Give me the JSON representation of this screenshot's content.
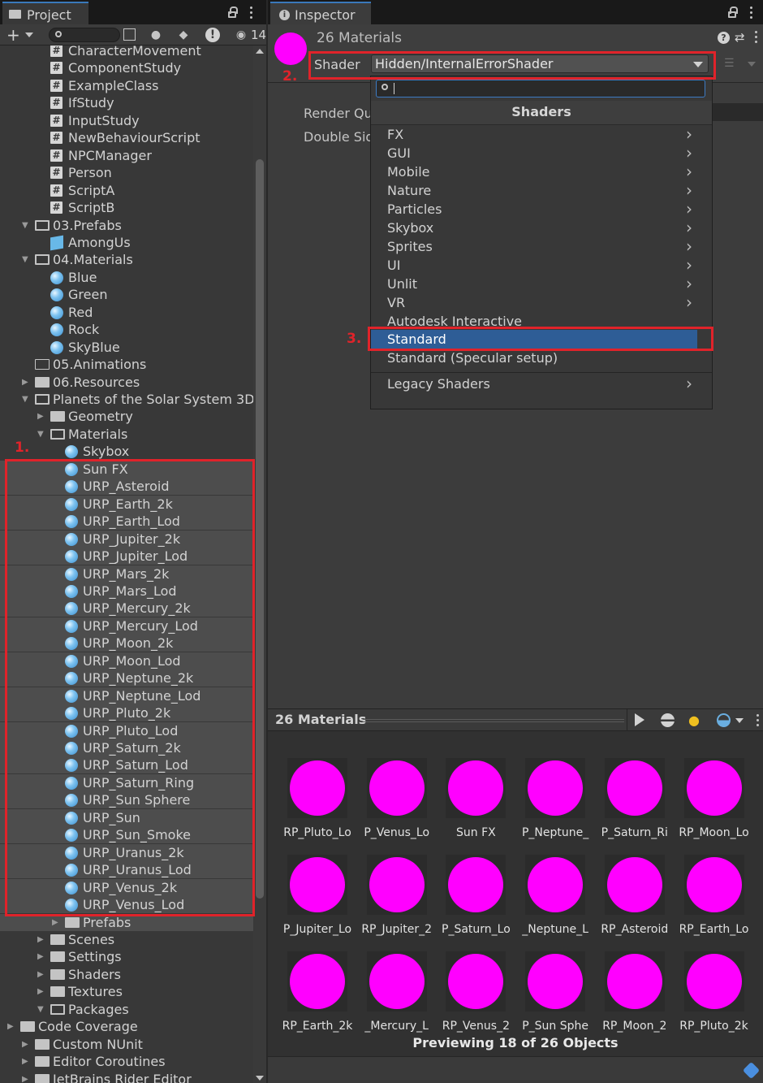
{
  "project": {
    "tab_label": "Project",
    "hidden_count": "14",
    "tree": [
      {
        "label": "CharacterMovement",
        "type": "script"
      },
      {
        "label": "ComponentStudy",
        "type": "script"
      },
      {
        "label": "ExampleClass",
        "type": "script"
      },
      {
        "label": "IfStudy",
        "type": "script"
      },
      {
        "label": "InputStudy",
        "type": "script"
      },
      {
        "label": "NewBehaviourScript",
        "type": "script"
      },
      {
        "label": "NPCManager",
        "type": "script"
      },
      {
        "label": "Person",
        "type": "script"
      },
      {
        "label": "ScriptA",
        "type": "script"
      },
      {
        "label": "ScriptB",
        "type": "script"
      },
      {
        "label": "03.Prefabs",
        "type": "folder-open"
      },
      {
        "label": "AmongUs",
        "type": "prefab"
      },
      {
        "label": "04.Materials",
        "type": "folder-open"
      },
      {
        "label": "Blue",
        "type": "material"
      },
      {
        "label": "Green",
        "type": "material"
      },
      {
        "label": "Red",
        "type": "material"
      },
      {
        "label": "Rock",
        "type": "material"
      },
      {
        "label": "SkyBlue",
        "type": "material"
      },
      {
        "label": "05.Animations",
        "type": "folder-empty"
      },
      {
        "label": "06.Resources",
        "type": "folder"
      },
      {
        "label": "Planets of the Solar System 3D",
        "type": "folder-open"
      },
      {
        "label": "Geometry",
        "type": "folder"
      },
      {
        "label": "Materials",
        "type": "folder-open"
      },
      {
        "label": "Skybox",
        "type": "material"
      },
      {
        "label": "Sun FX",
        "type": "material"
      },
      {
        "label": "URP_Asteroid",
        "type": "material"
      },
      {
        "label": "URP_Earth_2k",
        "type": "material"
      },
      {
        "label": "URP_Earth_Lod",
        "type": "material"
      },
      {
        "label": "URP_Jupiter_2k",
        "type": "material"
      },
      {
        "label": "URP_Jupiter_Lod",
        "type": "material"
      },
      {
        "label": "URP_Mars_2k",
        "type": "material"
      },
      {
        "label": "URP_Mars_Lod",
        "type": "material"
      },
      {
        "label": "URP_Mercury_2k",
        "type": "material"
      },
      {
        "label": "URP_Mercury_Lod",
        "type": "material"
      },
      {
        "label": "URP_Moon_2k",
        "type": "material"
      },
      {
        "label": "URP_Moon_Lod",
        "type": "material"
      },
      {
        "label": "URP_Neptune_2k",
        "type": "material"
      },
      {
        "label": "URP_Neptune_Lod",
        "type": "material"
      },
      {
        "label": "URP_Pluto_2k",
        "type": "material"
      },
      {
        "label": "URP_Pluto_Lod",
        "type": "material"
      },
      {
        "label": "URP_Saturn_2k",
        "type": "material"
      },
      {
        "label": "URP_Saturn_Lod",
        "type": "material"
      },
      {
        "label": "URP_Saturn_Ring",
        "type": "material"
      },
      {
        "label": "URP_Sun Sphere",
        "type": "material"
      },
      {
        "label": "URP_Sun",
        "type": "material"
      },
      {
        "label": "URP_Sun_Smoke",
        "type": "material"
      },
      {
        "label": "URP_Uranus_2k",
        "type": "material"
      },
      {
        "label": "URP_Uranus_Lod",
        "type": "material"
      },
      {
        "label": "URP_Venus_2k",
        "type": "material"
      },
      {
        "label": "URP_Venus_Lod",
        "type": "material"
      },
      {
        "label": "Prefabs",
        "type": "folder"
      },
      {
        "label": "Scenes",
        "type": "folder"
      },
      {
        "label": "Settings",
        "type": "folder"
      },
      {
        "label": "Shaders",
        "type": "folder"
      },
      {
        "label": "Textures",
        "type": "folder"
      },
      {
        "label": "Packages",
        "type": "folder-open"
      },
      {
        "label": "Code Coverage",
        "type": "folder"
      },
      {
        "label": "Custom NUnit",
        "type": "folder"
      },
      {
        "label": "Editor Coroutines",
        "type": "folder"
      },
      {
        "label": "JetBrains Rider Editor",
        "type": "folder"
      }
    ]
  },
  "inspector": {
    "tab_label": "Inspector",
    "title": "26 Materials",
    "shader_label": "Shader",
    "shader_value": "Hidden/InternalErrorShader",
    "render_queue_label": "Render Qu",
    "double_sided_label": "Double Sid"
  },
  "dropdown": {
    "header": "Shaders",
    "items": [
      {
        "label": "FX",
        "submenu": true
      },
      {
        "label": "GUI",
        "submenu": true
      },
      {
        "label": "Mobile",
        "submenu": true
      },
      {
        "label": "Nature",
        "submenu": true
      },
      {
        "label": "Particles",
        "submenu": true
      },
      {
        "label": "Skybox",
        "submenu": true
      },
      {
        "label": "Sprites",
        "submenu": true
      },
      {
        "label": "UI",
        "submenu": true
      },
      {
        "label": "Unlit",
        "submenu": true
      },
      {
        "label": "VR",
        "submenu": true
      },
      {
        "label": "Autodesk Interactive",
        "submenu": false
      },
      {
        "label": "Standard",
        "submenu": false,
        "selected": true
      },
      {
        "label": "Standard (Specular setup)",
        "submenu": false
      },
      {
        "label": "Legacy Shaders",
        "submenu": true
      }
    ]
  },
  "annotations": {
    "step1": "1.",
    "step2": "2.",
    "step3": "3.",
    "color": "#e0232a"
  },
  "preview": {
    "title": "26 Materials",
    "caption": "Previewing 18 of 26 Objects",
    "thumb_color": "#ff00ff",
    "thumbs": [
      "RP_Pluto_Lo",
      "P_Venus_Lo",
      "Sun FX",
      "P_Neptune_",
      "P_Saturn_Ri",
      "RP_Moon_Lo",
      "P_Jupiter_Lo",
      "RP_Jupiter_2",
      "P_Saturn_Lo",
      "_Neptune_L",
      "RP_Asteroid",
      "RP_Earth_Lo",
      "RP_Earth_2k",
      "_Mercury_L",
      "RP_Venus_2",
      "P_Sun Sphe",
      "RP_Moon_2",
      "RP_Pluto_2k"
    ]
  }
}
